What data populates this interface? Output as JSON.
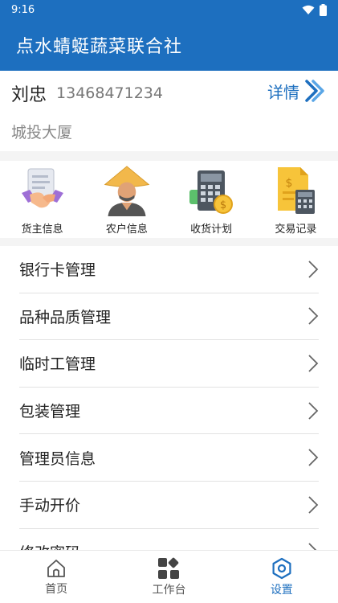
{
  "status": {
    "time": "9:16"
  },
  "app": {
    "title": "点水蜻蜓蔬菜联合社"
  },
  "profile": {
    "name": "刘忠",
    "phone": "13468471234",
    "detail_label": "详情",
    "address": "城投大厦"
  },
  "quick": [
    {
      "label": "货主信息",
      "icon": "handshake-document-icon"
    },
    {
      "label": "农户信息",
      "icon": "farmer-icon"
    },
    {
      "label": "收货计划",
      "icon": "calculator-coin-icon"
    },
    {
      "label": "交易记录",
      "icon": "invoice-calculator-icon"
    }
  ],
  "menu": [
    {
      "label": "银行卡管理"
    },
    {
      "label": "品种品质管理"
    },
    {
      "label": "临时工管理"
    },
    {
      "label": "包装管理"
    },
    {
      "label": "管理员信息"
    },
    {
      "label": "手动开价"
    },
    {
      "label": "修改密码"
    }
  ],
  "tabs": [
    {
      "label": "首页",
      "icon": "home-icon"
    },
    {
      "label": "工作台",
      "icon": "grid-icon"
    },
    {
      "label": "设置",
      "icon": "settings-icon",
      "active": true
    }
  ],
  "colors": {
    "primary": "#1d6fbf"
  }
}
